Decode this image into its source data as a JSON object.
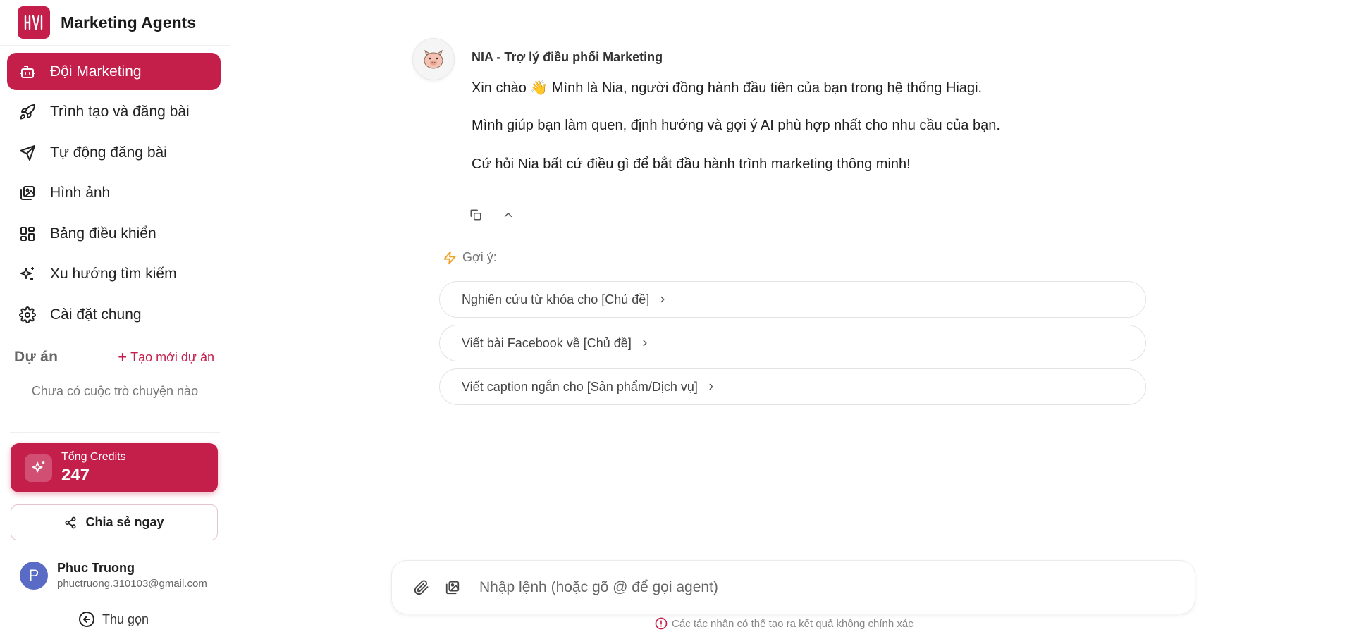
{
  "brand": {
    "name": "Marketing Agents"
  },
  "sidebar": {
    "items": [
      {
        "label": "Đội Marketing",
        "icon": "bot-icon",
        "active": true
      },
      {
        "label": "Trình tạo và đăng bài",
        "icon": "rocket-icon"
      },
      {
        "label": "Tự động đăng bài",
        "icon": "send-icon"
      },
      {
        "label": "Hình ảnh",
        "icon": "images-icon"
      },
      {
        "label": "Bảng điều khiển",
        "icon": "dashboard-icon"
      },
      {
        "label": "Xu hướng tìm kiếm",
        "icon": "sparkles-icon"
      },
      {
        "label": "Cài đặt chung",
        "icon": "gear-icon"
      }
    ],
    "projects_title": "Dự án",
    "new_project": "Tạo mới dự án",
    "empty_chats": "Chưa có cuộc trò chuyện nào",
    "credits": {
      "label": "Tổng Credits",
      "value": "247"
    },
    "share_label": "Chia sẻ ngay",
    "user": {
      "name": "Phuc Truong",
      "email": "phuctruong.310103@gmail.com",
      "initial": "P"
    },
    "collapse_label": "Thu gọn"
  },
  "chat": {
    "sender": "NIA - Trợ lý điều phối Marketing",
    "lines": [
      "Xin chào 👋 Mình là Nia, người đồng hành đầu tiên của bạn trong hệ thống Hiagi.",
      "Mình giúp bạn làm quen, định hướng và gợi ý AI phù hợp nhất cho nhu cầu của bạn.",
      "Cứ hỏi Nia bất cứ điều gì để bắt đầu hành trình marketing thông minh!"
    ],
    "suggest_title": "Gợi ý:",
    "suggestions": [
      "Nghiên cứu từ khóa cho [Chủ đề]",
      "Viết bài Facebook về [Chủ đề]",
      "Viết caption ngắn cho [Sản phẩm/Dịch vụ]"
    ]
  },
  "input": {
    "placeholder": "Nhập lệnh (hoặc gõ @ để gọi agent)",
    "value": ""
  },
  "disclaimer": "Các tác nhân có thể tạo ra kết quả không chính xác",
  "colors": {
    "accent": "#c41e4b",
    "avatar": "#5a6bc6",
    "lightning": "#f0a020"
  }
}
